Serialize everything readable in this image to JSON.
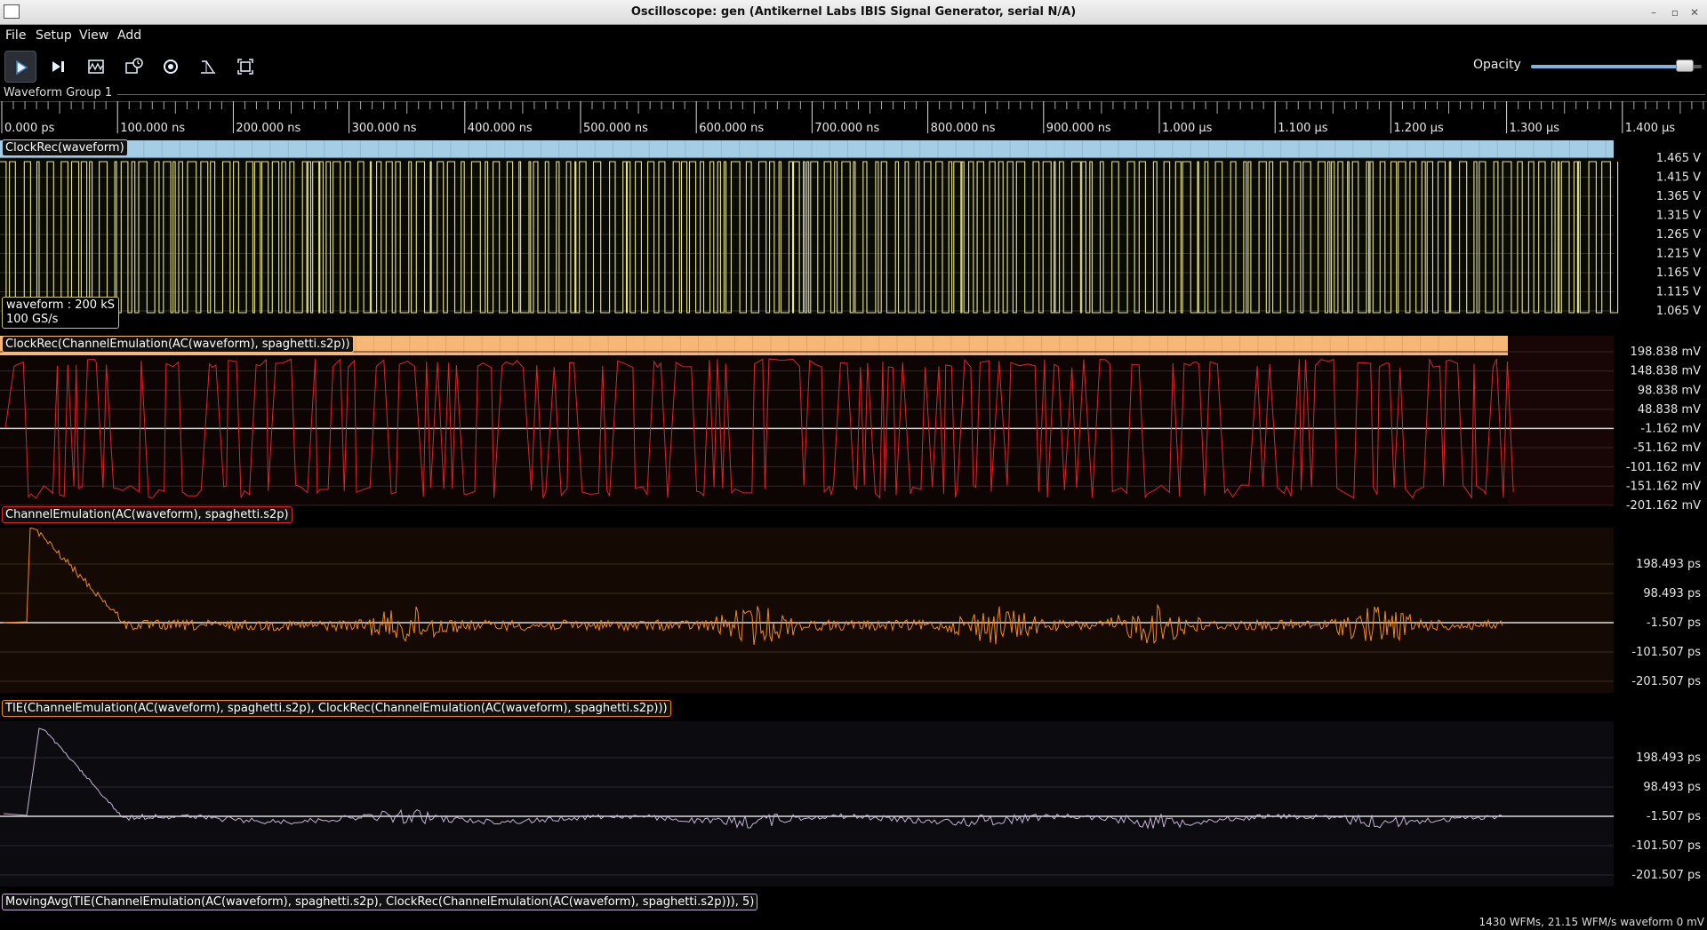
{
  "window": {
    "title": "Oscilloscope: gen (Antikernel Labs IBIS Signal Generator, serial N/A)"
  },
  "menu": [
    "File",
    "Setup",
    "View",
    "Add"
  ],
  "toolbar": {
    "buttons": [
      {
        "name": "run-button",
        "icon": "play-icon",
        "active": true
      },
      {
        "name": "single-trigger-button",
        "icon": "step-icon",
        "active": false
      },
      {
        "name": "waveform-button",
        "icon": "waveform-icon",
        "active": false
      },
      {
        "name": "history-button",
        "icon": "history-icon",
        "active": false
      },
      {
        "name": "refresh-button",
        "icon": "refresh-icon",
        "active": false
      },
      {
        "name": "filter-button",
        "icon": "filter-icon",
        "active": false
      },
      {
        "name": "fullscreen-button",
        "icon": "fullscreen-icon",
        "active": false
      }
    ],
    "opacity_label": "Opacity",
    "opacity_value": 0.9
  },
  "waveform_group": {
    "title": "Waveform Group 1"
  },
  "timeline": {
    "labels": [
      "0.000 ps",
      "100.000 ns",
      "200.000 ns",
      "300.000 ns",
      "400.000 ns",
      "500.000 ns",
      "600.000 ns",
      "700.000 ns",
      "800.000 ns",
      "900.000 ns",
      "1.000 µs",
      "1.100 µs",
      "1.200 µs",
      "1.300 µs",
      "1.400 µs"
    ]
  },
  "plots": [
    {
      "id": "clockrec-waveform",
      "eye_label": "ClockRec(waveform)",
      "trace_label": "",
      "info": [
        "waveform : 200 kS",
        "100 GS/s"
      ],
      "trace_color": "#e8e48a",
      "eye_color": "#a6cde6",
      "axis": [
        "1.465 V",
        "1.415 V",
        "1.365 V",
        "1.315 V",
        "1.265 V",
        "1.215 V",
        "1.165 V",
        "1.115 V",
        "1.065 V"
      ]
    },
    {
      "id": "clockrec-channelemulation",
      "eye_label": "ClockRec(ChannelEmulation(AC(waveform), spaghetti.s2p))",
      "trace_label": "ChannelEmulation(AC(waveform), spaghetti.s2p)",
      "trace_color": "#e0242a",
      "eye_color": "#f7b877",
      "axis": [
        "198.838 mV",
        "148.838 mV",
        "98.838 mV",
        "48.838 mV",
        "-1.162 mV",
        "-51.162 mV",
        "-101.162 mV",
        "-151.162 mV",
        "-201.162 mV"
      ]
    },
    {
      "id": "tie",
      "trace_label": "TIE(ChannelEmulation(AC(waveform), spaghetti.s2p), ClockRec(ChannelEmulation(AC(waveform), spaghetti.s2p)))",
      "trace_color": "#f08a1e",
      "axis": [
        "198.493 ps",
        "98.493 ps",
        "-1.507 ps",
        "-101.507 ps",
        "-201.507 ps"
      ]
    },
    {
      "id": "movingavg",
      "trace_label": "MovingAvg(TIE(ChannelEmulation(AC(waveform), spaghetti.s2p), ClockRec(ChannelEmulation(AC(waveform), spaghetti.s2p))), 5)",
      "trace_color": "#c4b4d6",
      "axis": [
        "198.493 ps",
        "98.493 ps",
        "-1.507 ps",
        "-101.507 ps",
        "-201.507 ps"
      ]
    }
  ],
  "status": "1430 WFMs, 21.15 WFM/s  waveform 0 mV"
}
